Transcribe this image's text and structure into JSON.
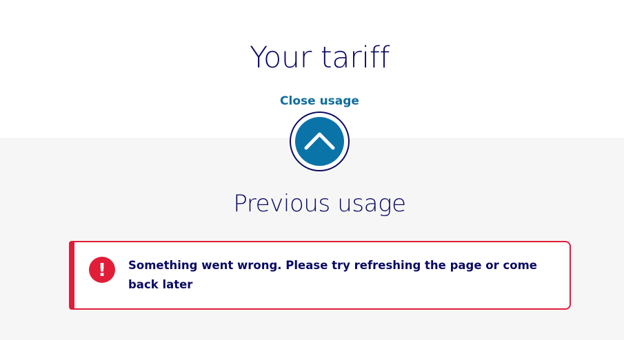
{
  "header": {
    "title": "Your tariff",
    "close_usage_label": "Close usage",
    "toggle_icon": "chevron-up-icon"
  },
  "usage": {
    "title": "Previous usage"
  },
  "error": {
    "icon": "exclamation-icon",
    "icon_glyph": "!",
    "message": "Something went wrong. Please try refreshing the page or come back later"
  },
  "colors": {
    "navy": "#0a0a63",
    "link_blue": "#0e6d9e",
    "button_blue": "#0a73a8",
    "error_red": "#e11d38",
    "panel_gray": "#f6f6f6"
  }
}
